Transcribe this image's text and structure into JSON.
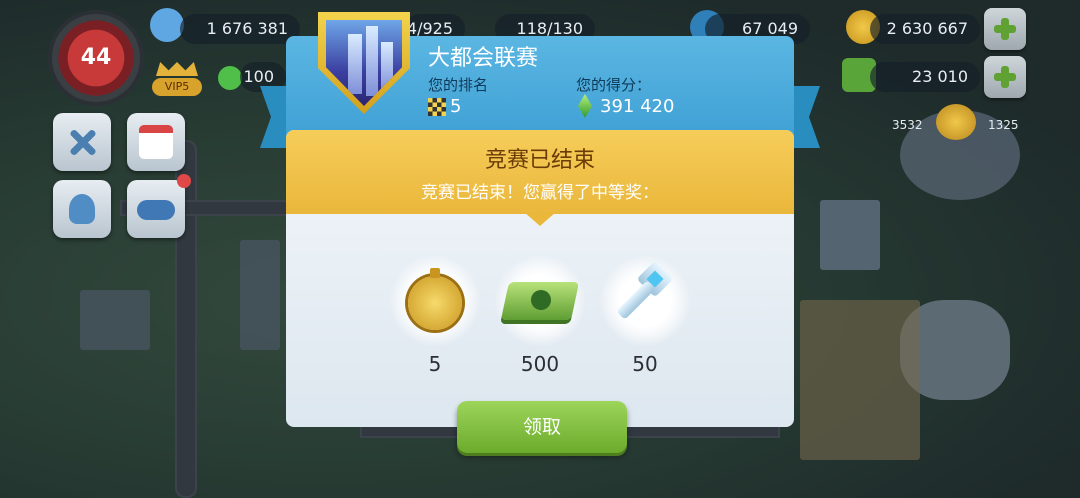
{
  "hud": {
    "level": "44",
    "population": "1 676 381",
    "capacity_1": "4/925",
    "capacity_2": "118/130",
    "blue_resource": "67 049",
    "simoleons": "2 630 667",
    "simcash": "23 010",
    "happiness": "100",
    "vip_label": "VIP5",
    "map_counter_1": "3532",
    "map_counter_2": "1325"
  },
  "contest": {
    "title": "大都会联赛",
    "rank_label": "您的排名",
    "rank_value": "5",
    "score_label": "您的得分：",
    "score_value": "391 420"
  },
  "result": {
    "heading": "竞赛已结束",
    "message": "竞赛已结束！您赢得了中等奖："
  },
  "rewards": [
    {
      "name": "speedup-token",
      "qty": "5"
    },
    {
      "name": "simoleon-cash",
      "qty": "500"
    },
    {
      "name": "key",
      "qty": "50"
    }
  ],
  "claim_label": "领取",
  "colors": {
    "header_blue": "#3d9fd4",
    "gold_banner": "#eab73b",
    "claim_green": "#6cab2c"
  }
}
